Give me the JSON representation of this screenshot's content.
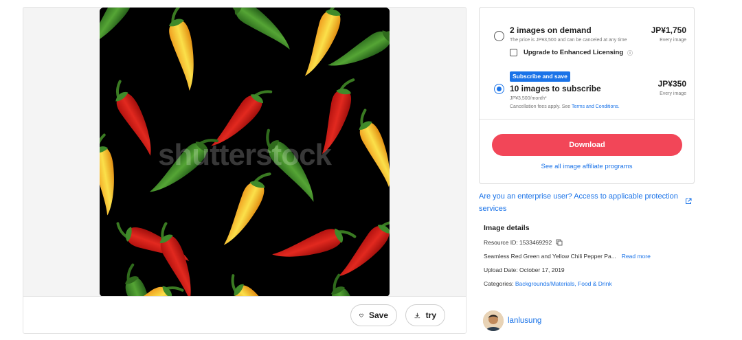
{
  "image": {
    "watermark": "shutterstock"
  },
  "actions": {
    "save_label": "Save",
    "try_label": "try"
  },
  "purchase": {
    "option1": {
      "title": "2 images on demand",
      "subtitle": "The price is JP¥3,500 and can be canceled at any time",
      "price": "JP¥1,750",
      "unit": "Every image",
      "checkbox_label": "Upgrade to Enhanced Licensing",
      "selected": false
    },
    "option2": {
      "badge": "Subscribe and save",
      "title": "10 images to subscribe",
      "subtitle": "JP¥3,500/month*",
      "note_prefix": "Cancellation fees apply. See ",
      "note_link": "Terms and Conditions.",
      "price": "JP¥350",
      "unit": "Every image",
      "selected": true
    },
    "download_label": "Download",
    "affiliate_link": "See all image affiliate programs"
  },
  "enterprise_link": "Are you an enterprise user? Access to applicable protection services",
  "details": {
    "title": "Image details",
    "resource_id": "Resource ID: 1533469292",
    "description": "Seamless Red Green and Yellow Chili Pepper Pa...",
    "read_more": "Read more",
    "upload_date": "Upload Date: October 17, 2019",
    "categories_prefix": "Categories: ",
    "categories": "Backgrounds/Materials, Food & Drink"
  },
  "author": {
    "name": "lanlusung"
  },
  "colors": {
    "accent_blue": "#1a73e8",
    "download_red": "#f24658",
    "pepper_red": "#d9251d",
    "pepper_green": "#3f8a2a",
    "pepper_yellow": "#f5c518"
  }
}
